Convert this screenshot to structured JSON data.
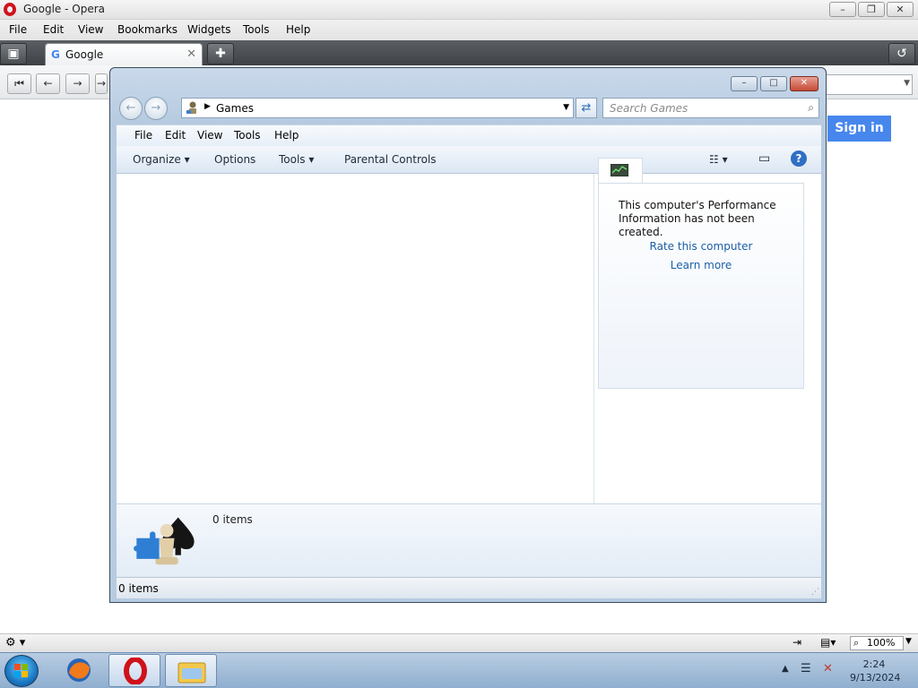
{
  "opera": {
    "title": "Google - Opera",
    "menu": [
      "File",
      "Edit",
      "View",
      "Bookmarks",
      "Widgets",
      "Tools",
      "Help"
    ],
    "tab_label": "Google",
    "google_signin": "Sign in",
    "zoom": "100%"
  },
  "games_window": {
    "address_crumb": "Games",
    "search_placeholder": "Search Games",
    "menu": [
      "File",
      "Edit",
      "View",
      "Tools",
      "Help"
    ],
    "toolbar": [
      "Organize",
      "Options",
      "Tools",
      "Parental Controls"
    ],
    "perf_text": "This computer's Performance Information has not been created.",
    "rate_link": "Rate this computer",
    "learn_link": "Learn more",
    "details_count": "0 items",
    "status_count": "0 items"
  },
  "taskbar": {
    "time": "2:24",
    "date": "9/13/2024"
  },
  "colors": {
    "accent_signin": "#4787ed",
    "opera_red": "#d0111b",
    "link_blue": "#1b5fa7"
  },
  "icons": [
    "opera-logo-icon",
    "google-g-icon",
    "games-folder-icon",
    "puzzle-chess-spade-icon",
    "windows-orb-icon",
    "firefox-icon",
    "opera-icon",
    "explorer-icon"
  ]
}
